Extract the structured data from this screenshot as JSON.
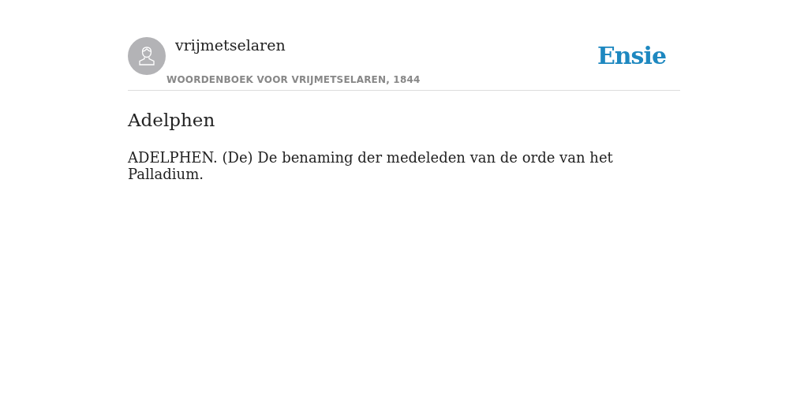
{
  "header": {
    "author": "vrijmetselaren",
    "source": "WOORDENBOEK VOOR VRIJMETSELAREN, 1844",
    "logo": "Ensie"
  },
  "entry": {
    "title": "Adelphen",
    "body": "ADELPHEN. (De) De benaming der medeleden van de orde van het Palladium."
  }
}
